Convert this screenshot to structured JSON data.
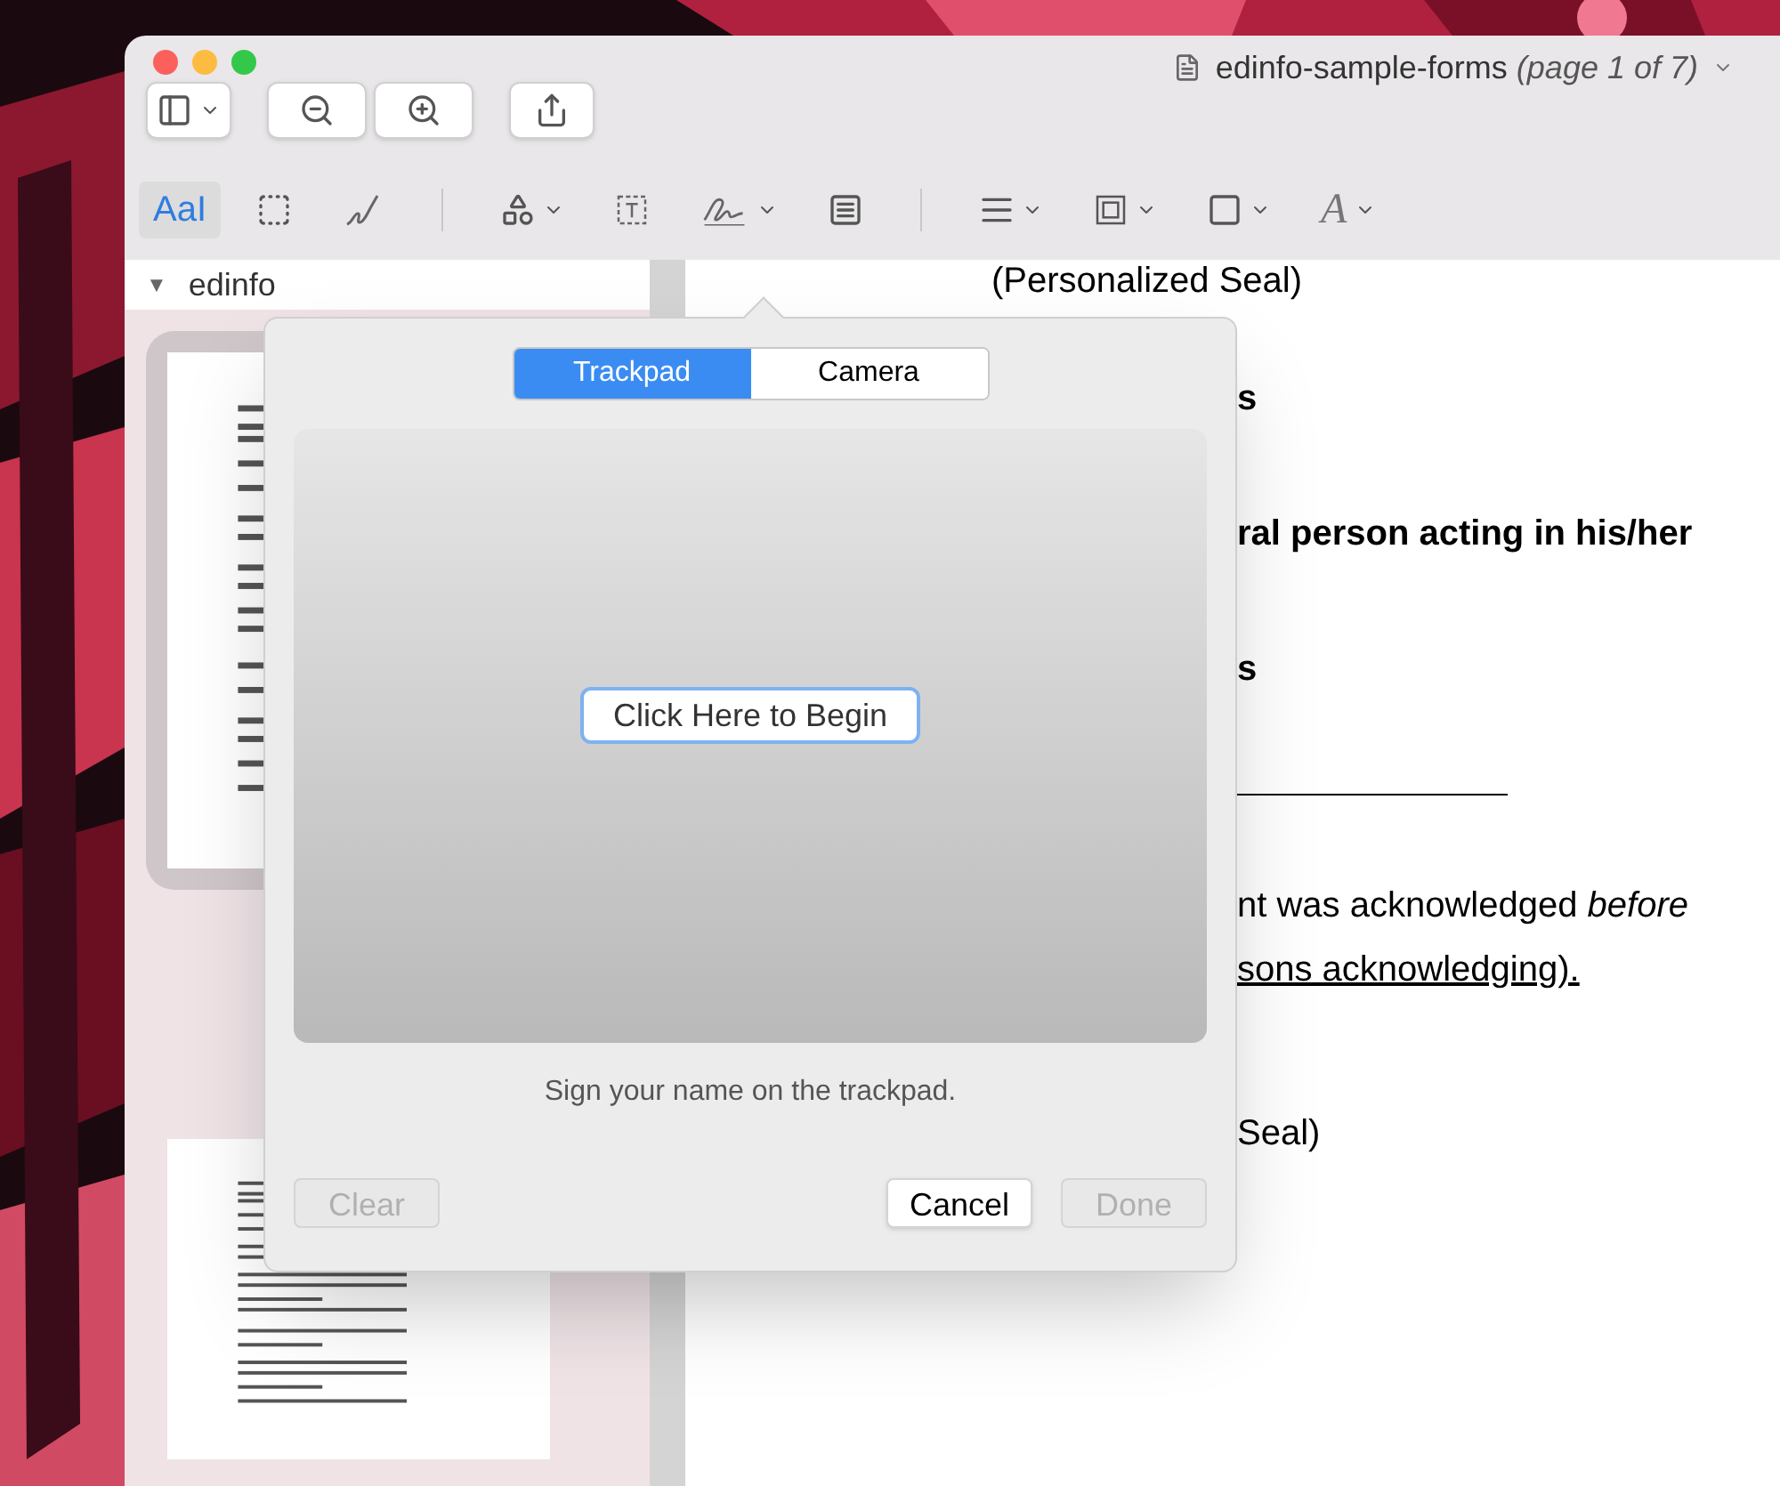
{
  "window": {
    "title": "edinfo-sample-forms",
    "subtitle": "(page 1 of 7)"
  },
  "toolbar": {
    "buttons": [
      {
        "kind": "sidebar"
      },
      {
        "kind": "zoom-out"
      },
      {
        "kind": "zoom-in"
      },
      {
        "kind": "share"
      }
    ]
  },
  "markup_tools": [
    {
      "kind": "text-select",
      "label": "AaI",
      "selected": true
    },
    {
      "kind": "rect-select",
      "selected": false
    },
    {
      "kind": "sketch",
      "selected": false
    },
    {
      "kind": "divider"
    },
    {
      "kind": "shapes",
      "selected": false
    },
    {
      "kind": "text-box",
      "selected": false
    },
    {
      "kind": "sign",
      "selected": false
    },
    {
      "kind": "note",
      "selected": false
    },
    {
      "kind": "divider"
    },
    {
      "kind": "line-style",
      "selected": false
    },
    {
      "kind": "border-color",
      "selected": false
    },
    {
      "kind": "fill-color",
      "selected": false
    },
    {
      "kind": "font",
      "label": "A",
      "selected": false
    }
  ],
  "sidebar": {
    "title": "edinfo",
    "expanded": true,
    "toggle": "▼"
  },
  "document": {
    "lines": [
      {
        "kind": "seal",
        "text": "(Personalized Seal)"
      },
      {
        "kind": "bold",
        "text": "s"
      },
      {
        "kind": "bold",
        "text": "ral person acting in his/her"
      },
      {
        "kind": "bold",
        "text": "s"
      },
      {
        "kind": "rule"
      },
      {
        "kind": "plain",
        "text": "nt was acknowledged *before*"
      },
      {
        "kind": "underlined",
        "text": "sons acknowledging)."
      },
      {
        "kind": "plain",
        "text": "Seal)"
      }
    ]
  },
  "signature_popover": {
    "tabs": [
      {
        "label": "Trackpad",
        "selected": true
      },
      {
        "label": "Camera",
        "selected": false
      }
    ],
    "begin_button": "Click Here to Begin",
    "hint": "Sign your name on the trackpad.",
    "buttons": [
      {
        "label": "Clear",
        "disabled": true,
        "kind": "left"
      },
      {
        "label": "Cancel",
        "disabled": false,
        "kind": "right"
      },
      {
        "label": "Done",
        "disabled": true,
        "kind": "right"
      }
    ]
  }
}
